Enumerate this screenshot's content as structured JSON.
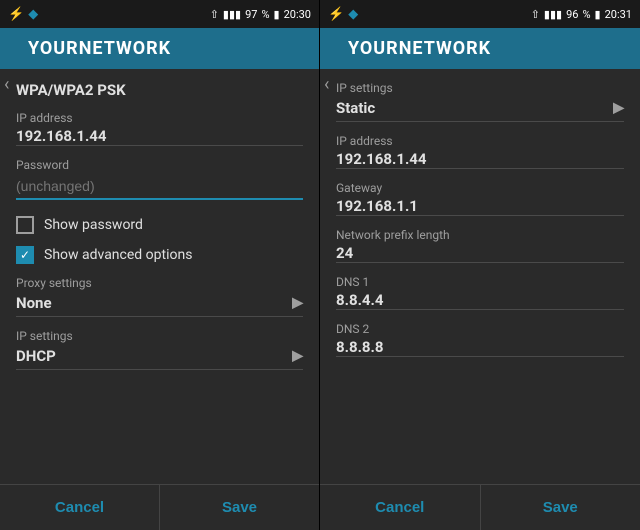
{
  "left": {
    "status_bar": {
      "left_icons": "☰ ☁",
      "signal": "▲▼",
      "battery": "97",
      "time": "20:30"
    },
    "header": {
      "title": "YOURNETWORK"
    },
    "security_label": "WPA/WPA2 PSK",
    "ip_label": "IP address",
    "ip_value": "192.168.1.44",
    "password_label": "Password",
    "password_placeholder": "(unchanged)",
    "show_password_label": "Show password",
    "show_advanced_label": "Show advanced options",
    "proxy_label": "Proxy settings",
    "proxy_value": "None",
    "ip_settings_label": "IP settings",
    "ip_settings_value": "DHCP",
    "cancel_label": "Cancel",
    "save_label": "Save"
  },
  "right": {
    "status_bar": {
      "signal": "▲▼",
      "battery": "96",
      "time": "20:31"
    },
    "header": {
      "title": "YOURNETWORK"
    },
    "ip_settings_label": "IP settings",
    "ip_settings_value": "Static",
    "ip_address_label": "IP address",
    "ip_address_value": "192.168.1.44",
    "gateway_label": "Gateway",
    "gateway_value": "192.168.1.1",
    "network_prefix_label": "Network prefix length",
    "network_prefix_value": "24",
    "dns1_label": "DNS 1",
    "dns1_value": "8.8.4.4",
    "dns2_label": "DNS 2",
    "dns2_value": "8.8.8.8",
    "cancel_label": "Cancel",
    "save_label": "Save"
  }
}
